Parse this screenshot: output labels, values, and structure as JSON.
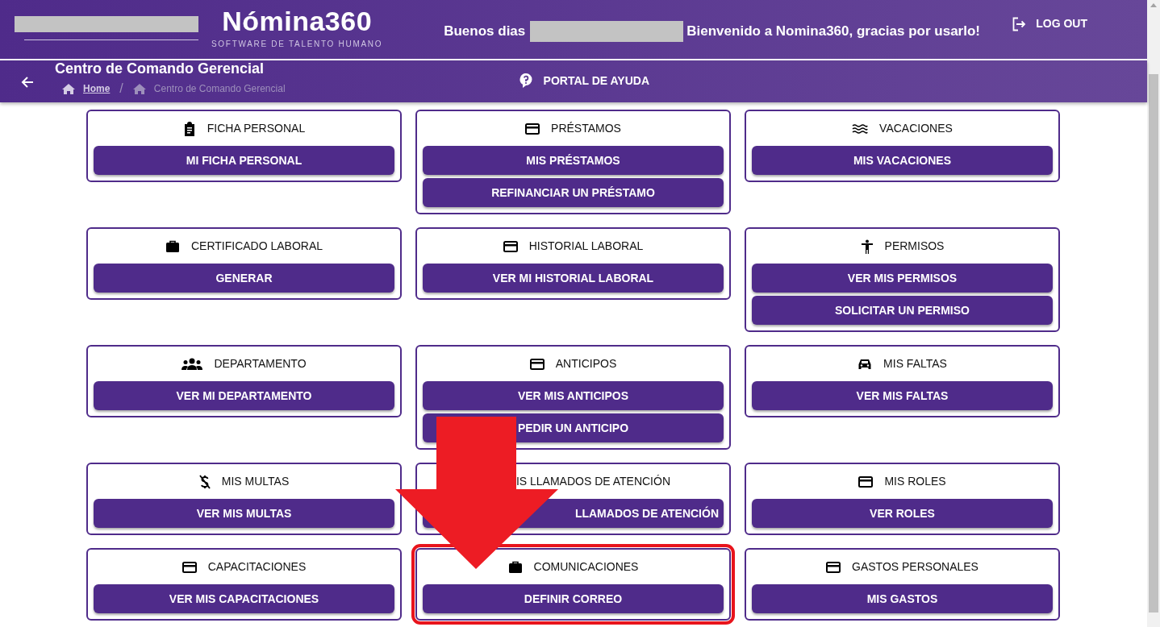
{
  "header": {
    "logo": "Nómina360",
    "tagline": "SOFTWARE DE TALENTO HUMANO",
    "greeting": "Buenos dias",
    "welcome": "Bienvenido a Nomina360, gracias por usarlo!",
    "logout": "LOG OUT"
  },
  "subheader": {
    "title": "Centro de Comando Gerencial",
    "separator": "/",
    "breadcrumb": [
      {
        "label": "Home",
        "current": false
      },
      {
        "label": "Centro de Comando Gerencial",
        "current": true
      }
    ],
    "help": "PORTAL DE AYUDA"
  },
  "cards": [
    {
      "title": "FICHA PERSONAL",
      "highlighted": false,
      "obscured": false,
      "buttons": [
        "MI FICHA PERSONAL"
      ]
    },
    {
      "title": "PRÉSTAMOS",
      "highlighted": false,
      "obscured": false,
      "buttons": [
        "MIS PRÉSTAMOS",
        "REFINANCIAR UN PRÉSTAMO"
      ]
    },
    {
      "title": "VACACIONES",
      "highlighted": false,
      "obscured": false,
      "buttons": [
        "MIS VACACIONES"
      ]
    },
    {
      "title": "CERTIFICADO LABORAL",
      "highlighted": false,
      "obscured": false,
      "buttons": [
        "GENERAR"
      ]
    },
    {
      "title": "HISTORIAL LABORAL",
      "highlighted": false,
      "obscured": false,
      "buttons": [
        "VER MI HISTORIAL LABORAL"
      ]
    },
    {
      "title": "PERMISOS",
      "highlighted": false,
      "obscured": false,
      "buttons": [
        "VER MIS PERMISOS",
        "SOLICITAR UN PERMISO"
      ]
    },
    {
      "title": "DEPARTAMENTO",
      "highlighted": false,
      "obscured": false,
      "buttons": [
        "VER MI DEPARTAMENTO"
      ]
    },
    {
      "title": "ANTICIPOS",
      "highlighted": false,
      "obscured": false,
      "buttons": [
        "VER MIS ANTICIPOS",
        "PEDIR UN ANTICIPO"
      ]
    },
    {
      "title": "MIS FALTAS",
      "highlighted": false,
      "obscured": false,
      "buttons": [
        "VER MIS FALTAS"
      ]
    },
    {
      "title": "MIS MULTAS",
      "highlighted": false,
      "obscured": false,
      "buttons": [
        "VER MIS MULTAS"
      ]
    },
    {
      "title": "IS LLAMADOS DE ATENCIÓN",
      "highlighted": false,
      "obscured": true,
      "buttons": [
        "LLAMADOS DE ATENCIÓN"
      ]
    },
    {
      "title": "MIS ROLES",
      "highlighted": false,
      "obscured": false,
      "buttons": [
        "VER ROLES"
      ]
    },
    {
      "title": "CAPACITACIONES",
      "highlighted": false,
      "obscured": false,
      "buttons": [
        "VER MIS CAPACITACIONES"
      ]
    },
    {
      "title": "COMUNICACIONES",
      "highlighted": true,
      "obscured": false,
      "buttons": [
        "DEFINIR CORREO"
      ]
    },
    {
      "title": "GASTOS PERSONALES",
      "highlighted": false,
      "obscured": false,
      "buttons": [
        "MIS GASTOS"
      ]
    }
  ],
  "annotation": {
    "kind": "arrow"
  }
}
